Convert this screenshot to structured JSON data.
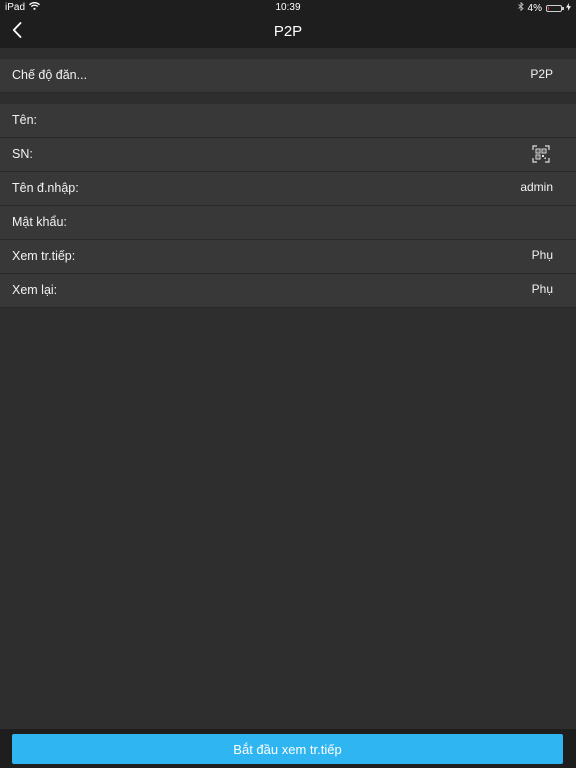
{
  "status_bar": {
    "device": "iPad",
    "time": "10:39",
    "battery": "4%",
    "battery_level": 0.04
  },
  "nav": {
    "title": "P2P",
    "back_icon": "chevron-left-icon"
  },
  "mode_row": {
    "label": "Chế độ đăn...",
    "value": "P2P"
  },
  "fields": [
    {
      "label": "Tên:",
      "value": ""
    },
    {
      "label": "SN:",
      "value": "",
      "icon": "qr-code-icon"
    },
    {
      "label": "Tên đ.nhập:",
      "value": "admin"
    },
    {
      "label": "Mật khẩu:",
      "value": ""
    },
    {
      "label": "Xem tr.tiếp:",
      "value": "Phụ"
    },
    {
      "label": "Xem lại:",
      "value": "Phụ"
    }
  ],
  "bottom": {
    "start_label": "Bắt đầu xem tr.tiếp"
  },
  "colors": {
    "accent": "#2fb5f1",
    "background": "#2e2e2e",
    "row": "#383838",
    "bar": "#1e1e1e"
  }
}
